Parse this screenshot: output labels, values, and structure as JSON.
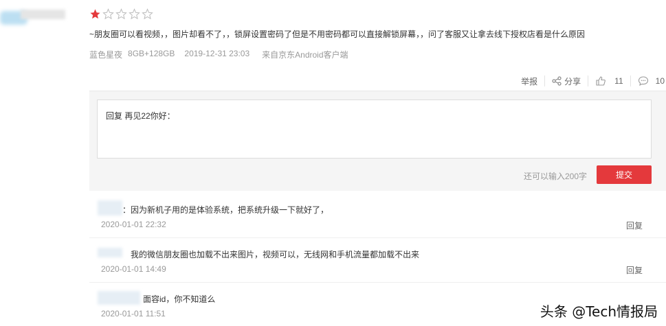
{
  "review": {
    "rating": 1,
    "max_rating": 5,
    "content": "~朋友圈可以看视频，，图片却看不了，，锁屏设置密码了但是不用密码都可以直接解锁屏幕，，问了客服又让拿去线下授权店看是什么原因",
    "color_variant": "蓝色星夜",
    "spec": "8GB+128GB",
    "datetime": "2019-12-31 23:03",
    "source": "来自京东Android客户端"
  },
  "actions": {
    "report_label": "举报",
    "share_label": "分享",
    "like_count": "11",
    "comment_count": "10"
  },
  "reply_form": {
    "prefix": "回复 再见22你好：",
    "char_hint": "还可以输入200字",
    "submit_label": "提交"
  },
  "replies": [
    {
      "text": "：因为新机子用的是体验系统，把系统升级一下就好了，",
      "date": "2020-01-01 22:32",
      "reply_label": "回复"
    },
    {
      "text": "我的微信朋友圈也加载不出来图片，视频可以，无线网和手机流量都加载不出来",
      "date": "2020-01-01 14:49",
      "reply_label": "回复"
    },
    {
      "text": "面容id，你不知道么",
      "date": "2020-01-01 11:51",
      "reply_label": ""
    }
  ],
  "watermark": "头条 @Tech情报局",
  "colors": {
    "accent": "#e4393c",
    "star_filled": "#e4393c",
    "star_empty": "#cccccc"
  }
}
